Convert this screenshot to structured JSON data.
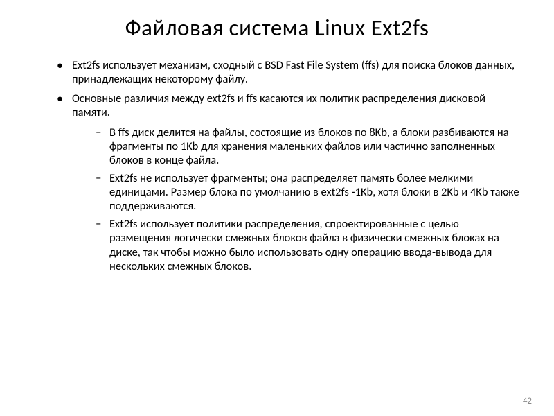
{
  "title": "Файловая система Linux Ext2fs",
  "bullets": [
    {
      "text": "Ext2fs использует механизм, сходный с BSD Fast File System (ffs) для поиска блоков данных, принадлежащих некоторому файлу."
    },
    {
      "text": "Основные различия между ext2fs и ffs касаются их политик распределения дисковой памяти.",
      "sub": [
        "В ffs диск делится на файлы, состоящие из блоков по 8Kb, а блоки разбиваются на фрагменты по 1Kb для хранения маленьких файлов или  частично заполненных блоков в конце файла.",
        "Ext2fs не использует фрагменты; она распределяет память более мелкими единицами.  Размер блока по умолчанию в ext2fs -1Kb, хотя блоки в 2Kb и 4Kb также поддерживаются.",
        "Ext2fs использует политики распределения, спроектированные с целью размещения логически смежных блоков файла в физически смежных блоках на диске, так чтобы можно было использовать одну операцию ввода-вывода для нескольких смежных блоков."
      ]
    }
  ],
  "page_number": "42"
}
